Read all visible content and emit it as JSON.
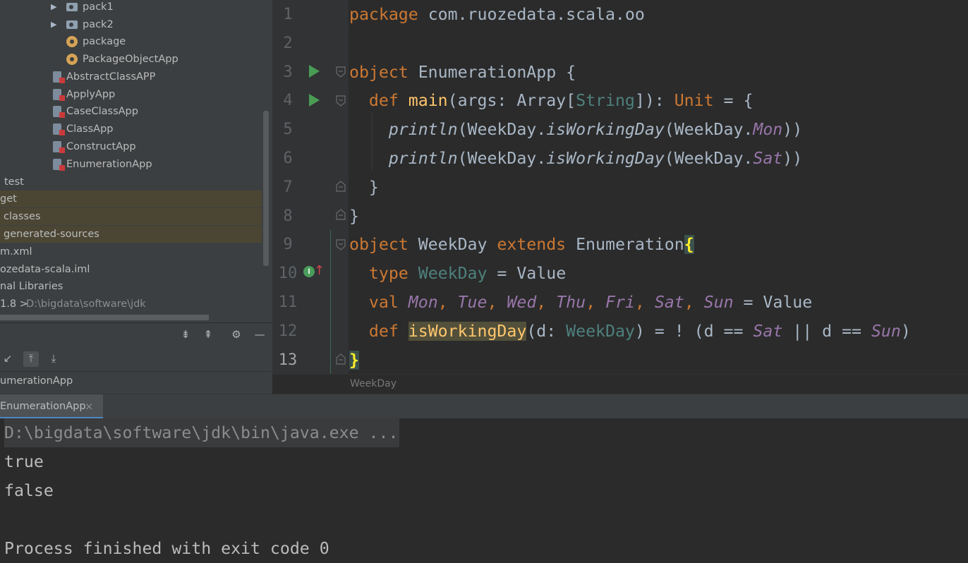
{
  "project_tree": {
    "items": [
      {
        "label": "pack1",
        "icon": "folder-icon",
        "arrow": "▶"
      },
      {
        "label": "pack2",
        "icon": "folder-icon",
        "arrow": "▶"
      },
      {
        "label": "package",
        "icon": "package-object-icon"
      },
      {
        "label": "PackageObjectApp",
        "icon": "package-object-icon"
      },
      {
        "label": "AbstractClassAPP",
        "icon": "scala-object-icon"
      },
      {
        "label": "ApplyApp",
        "icon": "scala-object-icon"
      },
      {
        "label": "CaseClassApp",
        "icon": "scala-object-icon"
      },
      {
        "label": "ClassApp",
        "icon": "scala-object-icon"
      },
      {
        "label": "ConstructApp",
        "icon": "scala-object-icon"
      },
      {
        "label": "EnumerationApp",
        "icon": "scala-object-icon"
      },
      {
        "label": "test"
      },
      {
        "label": "get"
      },
      {
        "label": "classes"
      },
      {
        "label": "generated-sources"
      },
      {
        "label": "m.xml"
      },
      {
        "label": "ozedata-scala.iml"
      },
      {
        "label": "nal Libraries"
      },
      {
        "label": "1.8 >",
        "extra": "D:\\bigdata\\software\\jdk"
      }
    ]
  },
  "structure": {
    "item": "umerationApp",
    "icons": [
      "expand-all-icon",
      "collapse-all-icon",
      "gear-icon",
      "hide-icon",
      "sort-icon",
      "sort-up-icon",
      "sort-down-icon"
    ]
  },
  "editor": {
    "line_numbers": [
      "1",
      "2",
      "3",
      "4",
      "5",
      "6",
      "7",
      "8",
      "9",
      "10",
      "11",
      "12",
      "13"
    ],
    "breadcrumb": "WeekDay",
    "code": {
      "l1": {
        "kw": "package",
        "rest": " com.ruozedata.scala.oo"
      },
      "l3": {
        "kw": "object",
        "name": " EnumerationApp ",
        "brace": "{"
      },
      "l4": {
        "indent": "  ",
        "kw": "def",
        "sp": " ",
        "fn": "main",
        "p1": "(args: Array[",
        "ty": "String",
        "p2": "]): ",
        "kw2": "Unit",
        "p3": " = {"
      },
      "l5": {
        "indent": "    ",
        "fn": "println",
        "p1": "(WeekDay.",
        "fn2": "isWorkingDay",
        "p2": "(WeekDay.",
        "cst": "Mon",
        "p3": "))"
      },
      "l6": {
        "indent": "    ",
        "fn": "println",
        "p1": "(WeekDay.",
        "fn2": "isWorkingDay",
        "p2": "(WeekDay.",
        "cst": "Sat",
        "p3": "))"
      },
      "l7": {
        "text": "  }"
      },
      "l8": {
        "text": "}"
      },
      "l9": {
        "kw": "object",
        "name": " WeekDay ",
        "kw2": "extends",
        "name2": " Enumeration",
        "brace": "{"
      },
      "l10": {
        "indent": "  ",
        "kw": "type",
        "sp": " ",
        "ty": "WeekDay",
        "rest": " = Value"
      },
      "l11": {
        "indent": "  ",
        "kw": "val",
        "sp": " ",
        "vals": [
          "Mon",
          "Tue",
          "Wed",
          "Thu",
          "Fri",
          "Sat",
          "Sun"
        ],
        "sep": ", ",
        "rest": " = Value"
      },
      "l12": {
        "indent": "  ",
        "kw": "def",
        "sp": " ",
        "fn": "isWorkingDay",
        "p1": "(d: ",
        "ty": "WeekDay",
        "p2": ") = ! (d == ",
        "c1": "Sat",
        "p3": " || d == ",
        "c2": "Sun",
        "p4": ")"
      },
      "l13": {
        "brace": "}"
      }
    }
  },
  "run": {
    "tab_label": "EnumerationApp",
    "tab_close": "×",
    "console": {
      "cmd": "D:\\bigdata\\software\\jdk\\bin\\java.exe ...",
      "out1": "true",
      "out2": "false",
      "exit": "Process finished with exit code 0"
    }
  },
  "colors": {
    "keyword": "#cc7832",
    "function": "#ffc66d",
    "type": "#4e807d",
    "constant": "#9876aa",
    "text": "#a9b7c6",
    "run_green": "#499c54"
  }
}
